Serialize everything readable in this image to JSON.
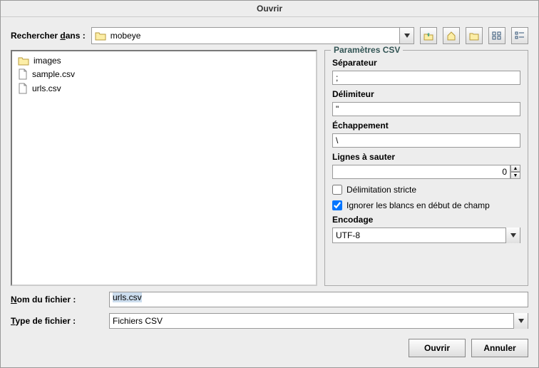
{
  "title": "Ouvrir",
  "search_in_label": "Rechercher dans :",
  "search_in_underline": "d",
  "current_dir": "mobeye",
  "files": [
    {
      "name": "images",
      "type": "folder"
    },
    {
      "name": "sample.csv",
      "type": "file"
    },
    {
      "name": "urls.csv",
      "type": "file"
    }
  ],
  "csv": {
    "legend": "Paramètres CSV",
    "separator_label": "Séparateur",
    "separator_value": ";",
    "delimiter_label": "Délimiteur",
    "delimiter_value": "\"",
    "escape_label": "Échappement",
    "escape_value": "\\",
    "skip_label": "Lignes à sauter",
    "skip_value": "0",
    "strict_label": "Délimitation stricte",
    "strict_checked": false,
    "ignore_ws_label": "Ignorer les blancs en début de champ",
    "ignore_ws_checked": true,
    "encoding_label": "Encodage",
    "encoding_value": "UTF-8"
  },
  "filename_label": "Nom du fichier :",
  "filename_underline": "N",
  "filename_value": "urls.csv",
  "filetype_label": "Type de fichier :",
  "filetype_underline": "T",
  "filetype_value": "Fichiers CSV",
  "open_btn": "Ouvrir",
  "cancel_btn": "Annuler"
}
